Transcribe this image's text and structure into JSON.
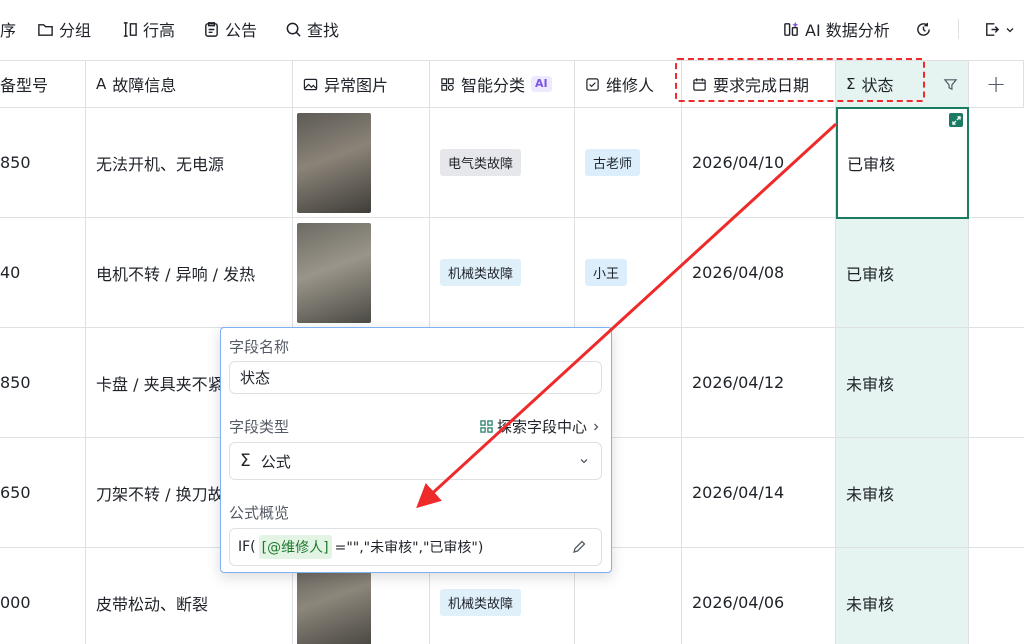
{
  "toolbar": {
    "sort_partial": "序",
    "group": "分组",
    "row_height": "行高",
    "notice": "公告",
    "find": "查找",
    "ai_analysis": "AI 数据分析"
  },
  "headers": {
    "device_model": "备型号",
    "fault_info": "故障信息",
    "abnormal_image": "异常图片",
    "smart_category": "智能分类",
    "ai_badge": "AI",
    "repairer": "维修人",
    "due_date": "要求完成日期",
    "status": "状态",
    "add_column": "+"
  },
  "rows": [
    {
      "model": "850",
      "fault": "无法开机、无电源",
      "category": "电气类故障",
      "category_kind": "elec",
      "repairer": "古老师",
      "due": "2026/04/10",
      "status": "已审核"
    },
    {
      "model": "40",
      "fault": "电机不转 / 异响 / 发热",
      "category": "机械类故障",
      "category_kind": "mech",
      "repairer": "小王",
      "due": "2026/04/08",
      "status": "已审核"
    },
    {
      "model": "850",
      "fault": "卡盘 / 夹具夹不紧",
      "category": "",
      "category_kind": "",
      "repairer": "",
      "due": "2026/04/12",
      "status": "未审核"
    },
    {
      "model": "650",
      "fault": "刀架不转 / 换刀故障",
      "category": "",
      "category_kind": "",
      "repairer": "",
      "due": "2026/04/14",
      "status": "未审核"
    },
    {
      "model": "000",
      "fault": "皮带松动、断裂",
      "category": "机械类故障",
      "category_kind": "mech",
      "repairer": "",
      "due": "2026/04/06",
      "status": "未审核"
    }
  ],
  "popup": {
    "field_name_label": "字段名称",
    "field_name_value": "状态",
    "field_type_label": "字段类型",
    "explore_link": "探索字段中心",
    "field_type_value": "公式",
    "formula_label": "公式概览",
    "formula_prefix": "IF(",
    "formula_ref": "[@维修人]",
    "formula_suffix": " =\"\",\"未审核\",\"已审核\")"
  },
  "colors": {
    "accent_green": "#1b7a62",
    "status_bg": "#e6f4f1",
    "annotation_red": "#ee2a2a",
    "ai_purple": "#7b56e0"
  }
}
